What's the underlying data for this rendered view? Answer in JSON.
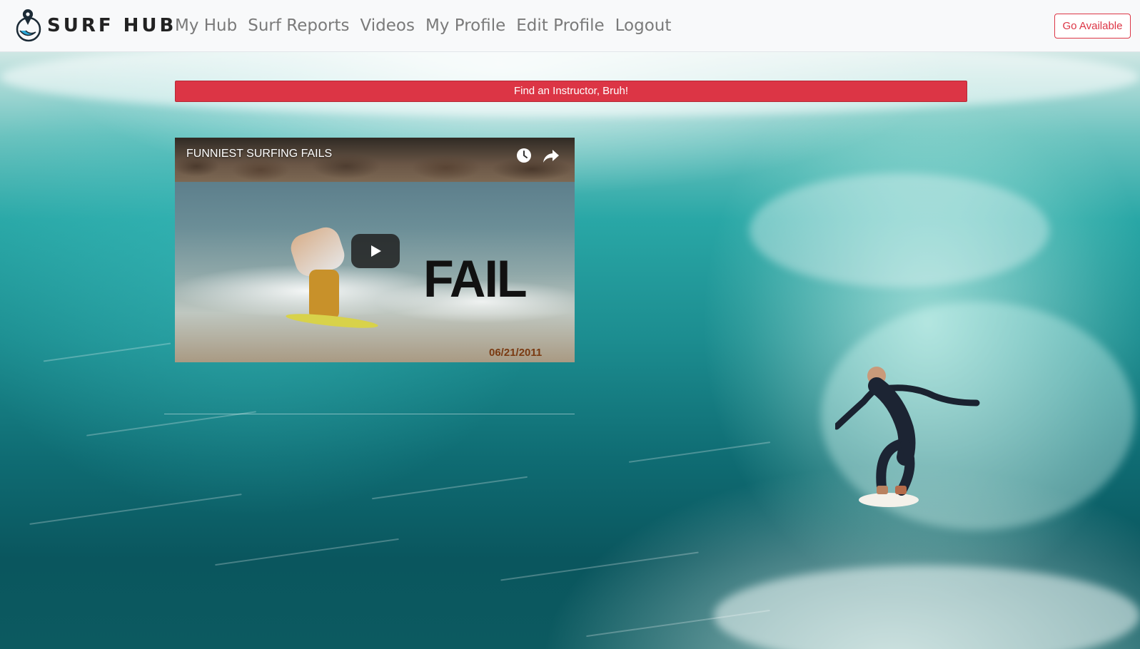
{
  "brand": {
    "name": "SURF HUB",
    "logo_icon": "location-pin-wave-icon"
  },
  "nav": {
    "items": [
      {
        "label": "My Hub"
      },
      {
        "label": "Surf Reports"
      },
      {
        "label": "Videos"
      },
      {
        "label": "My Profile"
      },
      {
        "label": "Edit Profile"
      },
      {
        "label": "Logout"
      }
    ],
    "go_available": "Go Available"
  },
  "main": {
    "instructor_button": "Find an Instructor, Bruh!",
    "video": {
      "title": "FUNNIEST SURFING FAILS",
      "overlay_text": "FAIL",
      "date": "06/21/2011",
      "icons": [
        "watch-later-icon",
        "share-icon",
        "play-icon"
      ]
    }
  },
  "colors": {
    "accent_red": "#dc3545",
    "navbar_bg": "#f8f9fa",
    "nav_link": "#7a7a7a"
  }
}
